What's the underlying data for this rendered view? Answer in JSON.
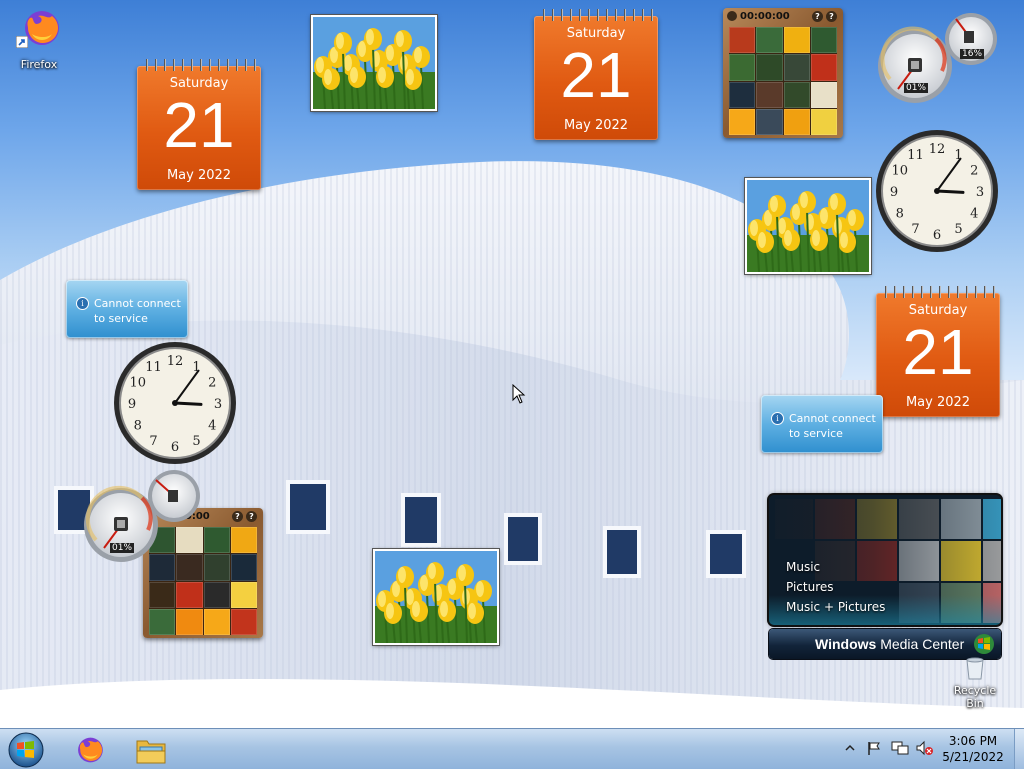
{
  "desktop_icons": [
    {
      "label": "Firefox",
      "icon": "firefox-icon"
    },
    {
      "label": "Recycle Bin",
      "icon": "recycle-bin-icon"
    }
  ],
  "calendar": {
    "weekday": "Saturday",
    "day": "21",
    "month_year": "May 2022"
  },
  "notice": {
    "line1": "Cannot connect",
    "line2": "to service"
  },
  "puzzle": {
    "timer": "00:00:00",
    "help": "?",
    "reset": "?"
  },
  "cpu_meter": [
    {
      "cpu": "01%",
      "memory": "16%"
    },
    {
      "cpu": "01%",
      "memory": ""
    }
  ],
  "clock": {
    "hour": 3,
    "minute": 6
  },
  "media_center": {
    "menu": [
      "Music",
      "Pictures",
      "Music + Pictures"
    ],
    "brand_bold": "Windows",
    "brand_rest": " Media Center"
  },
  "taskbar": {
    "start": "start-orb-icon",
    "pinned": [
      {
        "icon": "firefox-icon"
      },
      {
        "icon": "file-explorer-icon"
      }
    ],
    "tray_icons": [
      "show-hidden-icons-chevron",
      "action-center-flag-icon",
      "network-icon",
      "volume-muted-icon"
    ],
    "time": "3:06 PM",
    "date": "5/21/2022"
  },
  "colors": {
    "calendar_orange": "#e05a12",
    "taskbar_blue": "#a7c4e3",
    "notice_blue": "#5fb0e2"
  }
}
